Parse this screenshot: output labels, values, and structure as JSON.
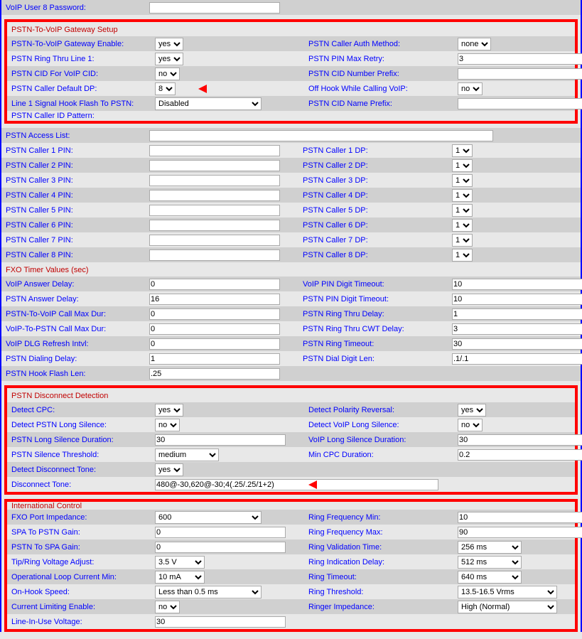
{
  "top": {
    "voip_user8_pw_label": "VoIP User 8 Password:",
    "voip_user8_pw": ""
  },
  "pstn_to_voip": {
    "section_title": "PSTN-To-VoIP Gateway Setup",
    "gateway_enable_label": "PSTN-To-VoIP Gateway Enable:",
    "gateway_enable": "yes",
    "caller_auth_method_label": "PSTN Caller Auth Method:",
    "caller_auth_method": "none",
    "ring_thru_line1_label": "PSTN Ring Thru Line 1:",
    "ring_thru_line1": "yes",
    "pin_max_retry_label": "PSTN PIN Max Retry:",
    "pin_max_retry": "3",
    "cid_for_voip_label": "PSTN CID For VoIP CID:",
    "cid_for_voip": "no",
    "cid_number_prefix_label": "PSTN CID Number Prefix:",
    "cid_number_prefix": "",
    "caller_default_dp_label": "PSTN Caller Default DP:",
    "caller_default_dp": "8",
    "off_hook_while_calling_label": "Off Hook While Calling VoIP:",
    "off_hook_while_calling": "no",
    "line1_signal_hook_flash_label": "Line 1 Signal Hook Flash To PSTN:",
    "line1_signal_hook_flash": "Disabled",
    "cid_name_prefix_label": "PSTN CID Name Prefix:",
    "cid_name_prefix": "",
    "caller_id_pattern_label": "PSTN Caller ID Pattern:"
  },
  "pstn_access": {
    "access_list_label": "PSTN Access List:",
    "access_list": "",
    "callers": [
      {
        "pin_label": "PSTN Caller 1 PIN:",
        "pin": "",
        "dp_label": "PSTN Caller 1 DP:",
        "dp": "1"
      },
      {
        "pin_label": "PSTN Caller 2 PIN:",
        "pin": "",
        "dp_label": "PSTN Caller 2 DP:",
        "dp": "1"
      },
      {
        "pin_label": "PSTN Caller 3 PIN:",
        "pin": "",
        "dp_label": "PSTN Caller 3 DP:",
        "dp": "1"
      },
      {
        "pin_label": "PSTN Caller 4 PIN:",
        "pin": "",
        "dp_label": "PSTN Caller 4 DP:",
        "dp": "1"
      },
      {
        "pin_label": "PSTN Caller 5 PIN:",
        "pin": "",
        "dp_label": "PSTN Caller 5 DP:",
        "dp": "1"
      },
      {
        "pin_label": "PSTN Caller 6 PIN:",
        "pin": "",
        "dp_label": "PSTN Caller 6 DP:",
        "dp": "1"
      },
      {
        "pin_label": "PSTN Caller 7 PIN:",
        "pin": "",
        "dp_label": "PSTN Caller 7 DP:",
        "dp": "1"
      },
      {
        "pin_label": "PSTN Caller 8 PIN:",
        "pin": "",
        "dp_label": "PSTN Caller 8 DP:",
        "dp": "1"
      }
    ]
  },
  "fxo_timers": {
    "section_title": "FXO Timer Values (sec)",
    "rows": [
      {
        "l": "VoIP Answer Delay:",
        "lv": "0",
        "r": "VoIP PIN Digit Timeout:",
        "rv": "10"
      },
      {
        "l": "PSTN Answer Delay:",
        "lv": "16",
        "r": "PSTN PIN Digit Timeout:",
        "rv": "10"
      },
      {
        "l": "PSTN-To-VoIP Call Max Dur:",
        "lv": "0",
        "r": "PSTN Ring Thru Delay:",
        "rv": "1"
      },
      {
        "l": "VoIP-To-PSTN Call Max Dur:",
        "lv": "0",
        "r": "PSTN Ring Thru CWT Delay:",
        "rv": "3"
      },
      {
        "l": "VoIP DLG Refresh Intvl:",
        "lv": "0",
        "r": "PSTN Ring Timeout:",
        "rv": "30"
      },
      {
        "l": "PSTN Dialing Delay:",
        "lv": "1",
        "r": "PSTN Dial Digit Len:",
        "rv": ".1/.1"
      }
    ],
    "hook_flash_len_label": "PSTN Hook Flash Len:",
    "hook_flash_len": ".25"
  },
  "disconnect": {
    "section_title": "PSTN Disconnect Detection",
    "detect_cpc_label": "Detect CPC:",
    "detect_cpc": "yes",
    "detect_polarity_label": "Detect Polarity Reversal:",
    "detect_polarity": "yes",
    "detect_long_silence_label": "Detect PSTN Long Silence:",
    "detect_long_silence": "no",
    "detect_voip_long_silence_label": "Detect VoIP Long Silence:",
    "detect_voip_long_silence": "no",
    "pstn_long_silence_dur_label": "PSTN Long Silence Duration:",
    "pstn_long_silence_dur": "30",
    "voip_long_silence_dur_label": "VoIP Long Silence Duration:",
    "voip_long_silence_dur": "30",
    "silence_threshold_label": "PSTN Silence Threshold:",
    "silence_threshold": "medium",
    "min_cpc_dur_label": "Min CPC Duration:",
    "min_cpc_dur": "0.2",
    "detect_disconnect_tone_label": "Detect Disconnect Tone:",
    "detect_disconnect_tone": "yes",
    "disconnect_tone_label": "Disconnect Tone:",
    "disconnect_tone": "480@-30,620@-30;4(.25/.25/1+2)"
  },
  "intl": {
    "section_title": "International Control",
    "fxo_port_impedance_label": "FXO Port Impedance:",
    "fxo_port_impedance": "600",
    "ring_freq_min_label": "Ring Frequency Min:",
    "ring_freq_min": "10",
    "spa_to_pstn_gain_label": "SPA To PSTN Gain:",
    "spa_to_pstn_gain": "0",
    "ring_freq_max_label": "Ring Frequency Max:",
    "ring_freq_max": "90",
    "pstn_to_spa_gain_label": "PSTN To SPA Gain:",
    "pstn_to_spa_gain": "0",
    "ring_validation_time_label": "Ring Validation Time:",
    "ring_validation_time": "256 ms",
    "tip_ring_voltage_label": "Tip/Ring Voltage Adjust:",
    "tip_ring_voltage": "3.5 V",
    "ring_indication_delay_label": "Ring Indication Delay:",
    "ring_indication_delay": "512 ms",
    "op_loop_current_min_label": "Operational Loop Current Min:",
    "op_loop_current_min": "10 mA",
    "ring_timeout_label": "Ring Timeout:",
    "ring_timeout": "640 ms",
    "on_hook_speed_label": "On-Hook Speed:",
    "on_hook_speed": "Less than 0.5 ms",
    "ring_threshold_label": "Ring Threshold:",
    "ring_threshold": "13.5-16.5 Vrms",
    "current_limiting_enable_label": "Current Limiting Enable:",
    "current_limiting_enable": "no",
    "ringer_impedance_label": "Ringer Impedance:",
    "ringer_impedance": "High (Normal)",
    "line_in_use_voltage_label": "Line-In-Use Voltage:",
    "line_in_use_voltage": "30"
  }
}
